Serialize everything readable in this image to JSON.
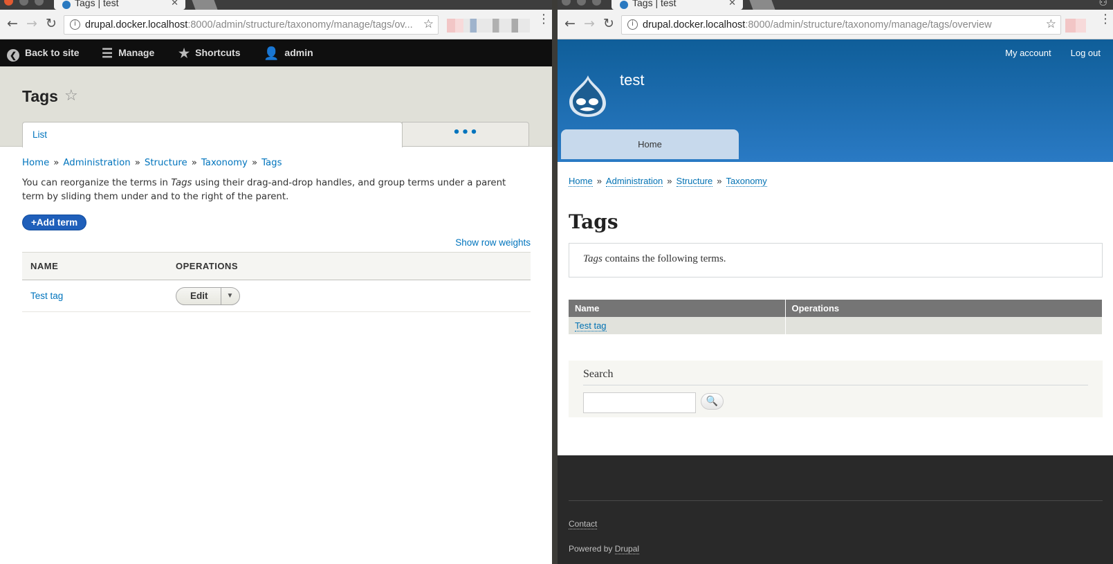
{
  "left_window": {
    "tab_title": "Tags | test",
    "url_host": "drupal.docker.localhost",
    "url_rest": ":8000/admin/structure/taxonomy/manage/tags/ov...",
    "admin_bar": {
      "back": "Back to site",
      "manage": "Manage",
      "shortcuts": "Shortcuts",
      "user": "admin"
    },
    "page_title": "Tags",
    "tabs": {
      "list": "List",
      "more": "•••"
    },
    "breadcrumb": [
      "Home",
      "Administration",
      "Structure",
      "Taxonomy",
      "Tags"
    ],
    "breadcrumb_sep": "»",
    "help_prefix": "You can reorganize the terms in ",
    "help_em": "Tags",
    "help_suffix": " using their drag-and-drop handles, and group terms under a parent term by sliding them under and to the right of the parent.",
    "add_term": "+Add term",
    "show_row_weights": "Show row weights",
    "table": {
      "headers": [
        "NAME",
        "OPERATIONS"
      ],
      "rows": [
        {
          "name": "Test tag",
          "operation": "Edit"
        }
      ]
    }
  },
  "right_window": {
    "tab_title": "Tags | test",
    "url_host": "drupal.docker.localhost",
    "url_rest": ":8000/admin/structure/taxonomy/manage/tags/overview",
    "user_menu": {
      "account": "My account",
      "logout": "Log out"
    },
    "site_name": "test",
    "main_menu": {
      "home": "Home"
    },
    "breadcrumb": [
      "Home",
      "Administration",
      "Structure",
      "Taxonomy"
    ],
    "breadcrumb_sep": "»",
    "page_title": "Tags",
    "notice_em": "Tags",
    "notice_suffix": " contains the following terms.",
    "table": {
      "headers": [
        "Name",
        "Operations"
      ],
      "rows": [
        {
          "name": "Test tag",
          "operations": ""
        }
      ]
    },
    "search": {
      "title": "Search",
      "value": ""
    },
    "footer": {
      "contact": "Contact",
      "powered_prefix": "Powered by ",
      "powered_link": "Drupal"
    }
  },
  "colors": {
    "admin_link": "#0074bd",
    "admin_button": "#1f5fba",
    "bartik_header_top": "#0f5e99",
    "bartik_header_bottom": "#2a7ac4",
    "footer_bg": "#292929"
  },
  "icons": [
    "chevron-left-circle-icon",
    "hamburger-icon",
    "star-icon",
    "user-icon",
    "favorite-star-icon",
    "search-icon",
    "drupal-drop-logo"
  ]
}
